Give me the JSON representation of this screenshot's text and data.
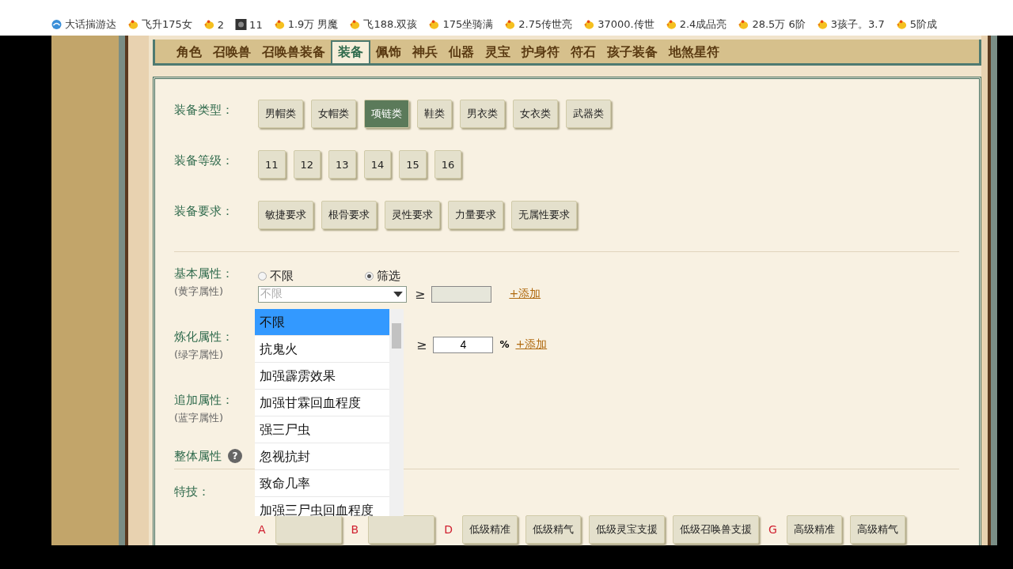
{
  "bookmarks": [
    {
      "kind": "site",
      "label": "大话揣游达"
    },
    {
      "kind": "chick",
      "label": "飞升175女"
    },
    {
      "kind": "chick",
      "label": "2"
    },
    {
      "kind": "image",
      "label": "11"
    },
    {
      "kind": "chick",
      "label": "1.9万 男魔"
    },
    {
      "kind": "chick",
      "label": "飞188.双孩"
    },
    {
      "kind": "chick",
      "label": "175坐骑满"
    },
    {
      "kind": "chick",
      "label": "2.75传世亮"
    },
    {
      "kind": "chick",
      "label": "37000.传世"
    },
    {
      "kind": "chick",
      "label": "2.4成品亮"
    },
    {
      "kind": "chick",
      "label": "28.5万 6阶"
    },
    {
      "kind": "chick",
      "label": "3孩子。3.7"
    },
    {
      "kind": "chick",
      "label": "5阶成"
    }
  ],
  "tabs": [
    {
      "label": "角色",
      "selected": false
    },
    {
      "label": "召唤兽",
      "selected": false
    },
    {
      "label": "召唤兽装备",
      "selected": false
    },
    {
      "label": "装备",
      "selected": true
    },
    {
      "label": "佩饰",
      "selected": false
    },
    {
      "label": "神兵",
      "selected": false
    },
    {
      "label": "仙器",
      "selected": false
    },
    {
      "label": "灵宝",
      "selected": false
    },
    {
      "label": "护身符",
      "selected": false
    },
    {
      "label": "符石",
      "selected": false
    },
    {
      "label": "孩子装备",
      "selected": false
    },
    {
      "label": "地煞星符",
      "selected": false
    }
  ],
  "filters": [
    {
      "label": "装备类型：",
      "options": [
        {
          "label": "男帽类",
          "selected": false
        },
        {
          "label": "女帽类",
          "selected": false
        },
        {
          "label": "项链类",
          "selected": true
        },
        {
          "label": "鞋类",
          "selected": false
        },
        {
          "label": "男衣类",
          "selected": false
        },
        {
          "label": "女衣类",
          "selected": false
        },
        {
          "label": "武器类",
          "selected": false
        }
      ]
    },
    {
      "label": "装备等级：",
      "options": [
        {
          "label": "11",
          "selected": false
        },
        {
          "label": "12",
          "selected": false
        },
        {
          "label": "13",
          "selected": false
        },
        {
          "label": "14",
          "selected": false
        },
        {
          "label": "15",
          "selected": false
        },
        {
          "label": "16",
          "selected": false
        }
      ]
    },
    {
      "label": "装备要求：",
      "options": [
        {
          "label": "敏捷要求",
          "selected": false
        },
        {
          "label": "根骨要求",
          "selected": false
        },
        {
          "label": "灵性要求",
          "selected": false
        },
        {
          "label": "力量要求",
          "selected": false
        },
        {
          "label": "无属性要求",
          "selected": false
        }
      ]
    }
  ],
  "basic": {
    "label": "基本属性：",
    "sublabel": "(黄字属性)",
    "radios": [
      {
        "label": "不限",
        "selected": false
      },
      {
        "label": "筛选",
        "selected": true
      }
    ],
    "select": {
      "value": "不限"
    },
    "compare": "≥",
    "add_link": "+添加"
  },
  "dropdown": {
    "options": [
      {
        "label": "不限",
        "selected": true
      },
      {
        "label": "抗鬼火",
        "selected": false
      },
      {
        "label": "加强霹雳效果",
        "selected": false
      },
      {
        "label": "加强甘霖回血程度",
        "selected": false
      },
      {
        "label": "强三尸虫",
        "selected": false
      },
      {
        "label": "忽视抗封",
        "selected": false
      },
      {
        "label": "致命几率",
        "selected": false
      },
      {
        "label": "加强三尸虫回血程度",
        "selected": false
      }
    ]
  },
  "refine": {
    "label": "炼化属性：",
    "sublabel": "(绿字属性)",
    "compare": "≥",
    "value": "4",
    "unit": "%",
    "add_link": "+添加"
  },
  "extra": {
    "label": "追加属性：",
    "sublabel": "(蓝字属性)"
  },
  "overall": {
    "label": "整体属性",
    "help": "?"
  },
  "skills": {
    "label": "特技：",
    "items": [
      {
        "kind": "letter",
        "text": "A"
      },
      {
        "kind": "covered"
      },
      {
        "kind": "letter",
        "text": "B"
      },
      {
        "kind": "covered"
      },
      {
        "kind": "letter",
        "text": "D"
      },
      {
        "kind": "button",
        "text": "低级精准"
      },
      {
        "kind": "button",
        "text": "低级精气"
      },
      {
        "kind": "button",
        "text": "低级灵宝支援"
      },
      {
        "kind": "button",
        "text": "低级召唤兽支援"
      },
      {
        "kind": "letter",
        "text": "G"
      },
      {
        "kind": "button",
        "text": "高级精准"
      },
      {
        "kind": "button",
        "text": "高级精气"
      }
    ]
  }
}
